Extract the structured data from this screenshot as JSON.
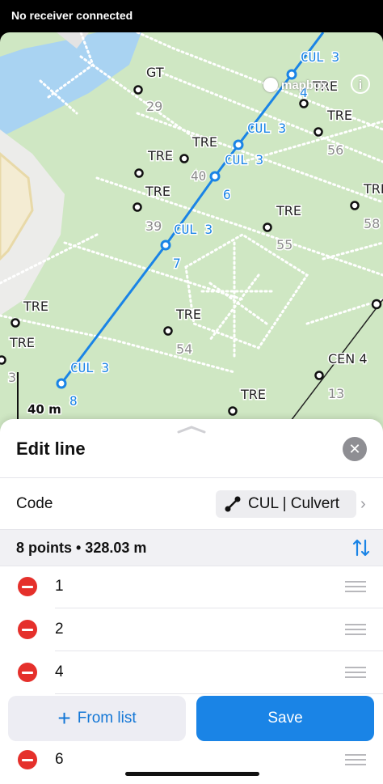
{
  "status_bar": {
    "text": "No receiver connected"
  },
  "map": {
    "logo_text": "mapbox",
    "info_icon": "i",
    "scale_label": "40 m",
    "colors": {
      "park": "#cfe7c3",
      "water": "#a9d3f2",
      "line": "#1a84e6"
    },
    "line_vertex_labels": [
      "CUL 3",
      "4",
      "CUL 3",
      "CUL 3",
      "40",
      "6",
      "CUL 3",
      "7",
      "CUL 3",
      "8"
    ],
    "point_labels": [
      "GT",
      "29",
      "TRE",
      "TRE",
      "56",
      "TRE",
      "TRE",
      "TRE",
      "TRE",
      "39",
      "TRE",
      "55",
      "58",
      "TRE",
      "TRE",
      "TRE",
      "54",
      "CEN 4",
      "13",
      "TRE",
      "3"
    ]
  },
  "sheet": {
    "title": "Edit line",
    "close_icon": "close-icon",
    "code_label": "Code",
    "code_value": "CUL | Culvert",
    "summary": "8 points • 328.03 m",
    "points": [
      "1",
      "2",
      "4",
      "",
      "6"
    ],
    "from_list_label": "From list",
    "save_label": "Save"
  }
}
